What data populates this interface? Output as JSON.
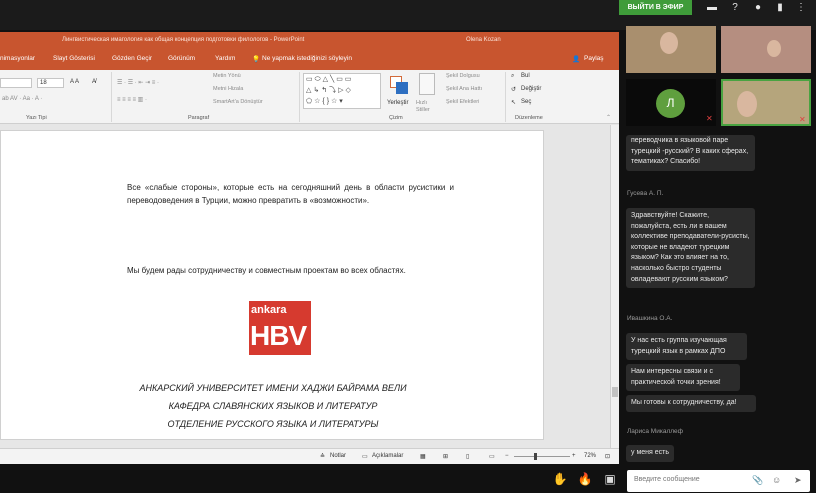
{
  "meeting": {
    "live_button": "ВЫЙТИ В ЭФИР",
    "top_icons": [
      "chat-icon",
      "help-icon",
      "user-icon",
      "file-icon",
      "more-icon"
    ]
  },
  "ppt": {
    "title": "Лингвистическая имагология как общая концепция подготовки филологов  -  PowerPoint",
    "user": "Olena Kozan",
    "tabs": [
      "nimasyonlar",
      "Slayt Gösterisi",
      "Gözden Geçir",
      "Görünüm",
      "Yardım",
      "Ne yapmak istediğinizi söyleyin",
      "Paylaş"
    ],
    "ribbon": {
      "font_size": "18",
      "paragraph_items": [
        "Metin Yönü",
        "Metni Hizala",
        "SmartArt'a Dönüştür"
      ],
      "arrange": "Yerleştir",
      "quick_styles": "Hızlı Stiller",
      "shape_items": [
        "Şekil Dolgusu",
        "Şekil Ana Hattı",
        "Şekil Efektleri"
      ],
      "edit_items": [
        "Bul",
        "Değiştir",
        "Seç"
      ],
      "groups": [
        "Yazı Tipi",
        "Paragraf",
        "Çizim",
        "Düzenleme"
      ]
    },
    "slide": {
      "paragraph1": "Все «слабые стороны», которые есть на сегодняшний день в области русистики и переводоведения в Турции, можно превратить в «возможности».",
      "paragraph2": "Мы будем рады сотрудничеству и совместным проектам во всех областях.",
      "logo_top": "ankara",
      "logo_bottom": "HBV",
      "uni_line1": "АНКАРСКИЙ УНИВЕРСИТЕТ ИМЕНИ ХАДЖИ БАЙРАМА ВЕЛИ",
      "uni_line2": "КАФЕДРА СЛАВЯНСКИХ ЯЗЫКОВ И ЛИТЕРАТУР",
      "uni_line3": "ОТДЕЛЕНИЕ РУССКОГО ЯЗЫКА И ЛИТЕРАТУРЫ"
    },
    "status": {
      "notes": "Notlar",
      "comments": "Açıklamalar",
      "zoom": "72%"
    }
  },
  "participants": {
    "avatar_letter": "Л"
  },
  "chat": {
    "messages": [
      {
        "text": "переводчика в языковой паре турецкий -русский? В каких сферах, тематиках? Спасибо!"
      },
      {
        "author": "Гусева А. П."
      },
      {
        "text": "Здравствуйте! Скажите, пожалуйста, есть ли в вашем коллективе преподаватели-русисты, которые не владеют турецким языком? Как это влияет на то, насколько быстро студенты овладевают русским языком?"
      },
      {
        "author": "Ивашкина О.А."
      },
      {
        "text": "У нас есть группа изучающая турецкий язык в рамках ДПО"
      },
      {
        "text": "Нам интересны связи и с практической точки зрения!"
      },
      {
        "text": "Мы готовы к сотрудничеству, да!"
      },
      {
        "author": "Лариса Микаллеф"
      },
      {
        "text": "у меня есть"
      }
    ],
    "input_placeholder": "Введите сообщение"
  }
}
